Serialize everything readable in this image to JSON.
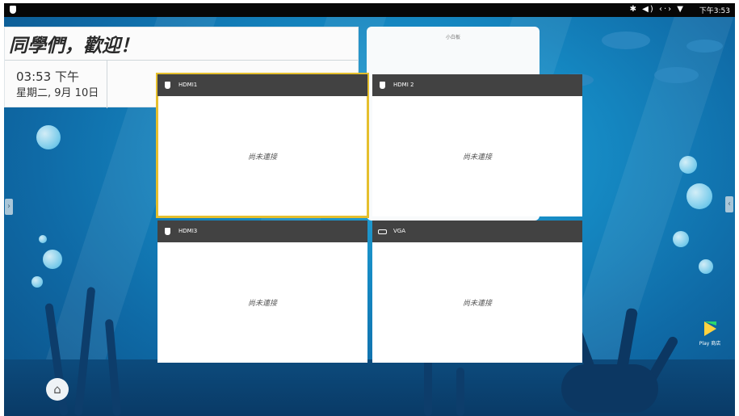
{
  "status_bar": {
    "icons": "✱ ◀) ‹·› ▼",
    "time": "下午3:53"
  },
  "welcome": {
    "title": "同學們，歡迎！",
    "time": "03:53 下午",
    "date": "星期二, 9月 10日"
  },
  "whiteboard": {
    "label": "小白板"
  },
  "tiles": [
    {
      "name": "HDMI1",
      "message": "尚未連接"
    },
    {
      "name": "HDMI 2",
      "message": "尚未連接"
    },
    {
      "name": "HDMI3",
      "message": "尚未連接"
    },
    {
      "name": "VGA",
      "message": "尚未連接"
    }
  ],
  "handles": {
    "left": "›",
    "right": "‹"
  },
  "home": {
    "glyph": "⌂"
  },
  "play_store": {
    "label": "Play 商店"
  },
  "colors": {
    "status_bar": "#070707",
    "tile_header": "#424242",
    "active_outline": "#e5bf2d",
    "ocean": "#1588c2"
  },
  "icons": [
    "shield-icon",
    "bluetooth-icon",
    "volume-icon",
    "network-icon",
    "wifi-icon",
    "hdmi-icon",
    "vga-icon",
    "home-icon",
    "play-store-icon",
    "chevron-right-icon",
    "chevron-left-icon"
  ]
}
